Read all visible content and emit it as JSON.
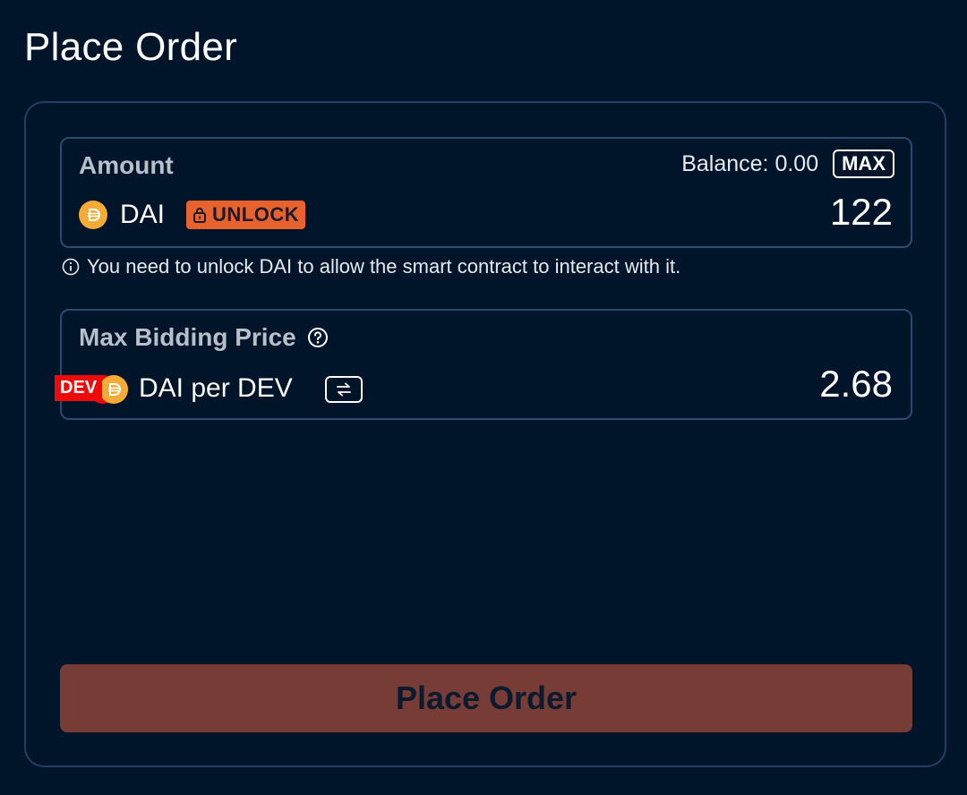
{
  "header": {
    "title": "Place Order"
  },
  "amount": {
    "label": "Amount",
    "balance": "Balance: 0.00",
    "max_label": "MAX",
    "token": "DAI",
    "unlock_label": "UNLOCK",
    "value": "122",
    "note": "You need to unlock DAI to allow the smart contract to interact with it."
  },
  "price": {
    "label": "Max Bidding Price",
    "dev_badge": "DEV",
    "pair": "DAI per DEV",
    "value": "2.68"
  },
  "submit": {
    "label": "Place Order"
  },
  "colors": {
    "background": "#001529",
    "unlock": "#e8622d",
    "dai_coin": "#f5ac37",
    "submit_disabled": "#763c35",
    "dev_badge": "#ee0a0a"
  },
  "icons": [
    "dai-coin-icon",
    "lock-icon",
    "info-icon",
    "help-icon",
    "swap-icon"
  ]
}
